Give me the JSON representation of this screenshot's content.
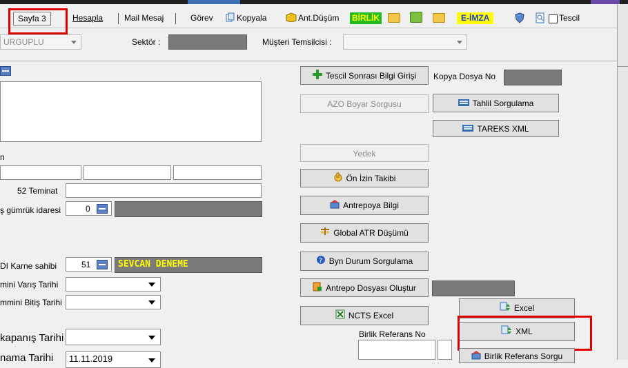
{
  "toolbar": {
    "sayfa3": "Sayfa 3",
    "hesapla": "Hesapla",
    "mail": "Mail Mesaj",
    "gorev": "Görev",
    "kopyala": "Kopyala",
    "ant_dusum": "Ant.Düşüm",
    "birlik": "BİRLİK",
    "eimza": "E-İMZA",
    "tescil": "Tescil"
  },
  "filters": {
    "office_value": "URGUPLU",
    "sektor_label": "Sektör :",
    "musteri_label": "Müşteri Temsilcisi :"
  },
  "left": {
    "fragment_n": "n",
    "teminat_label": "52 Teminat",
    "gumruk_label": "ş gümrük idaresi",
    "gumruk_value": "0",
    "karne_label": "DI Karne sahibi",
    "karne_value": "51",
    "karne_name": "SEVCAN DENEME",
    "varis_label": "mini Varış Tarihi",
    "bitis_label": "mmini Bitiş Tarihi",
    "kapanis_label": "kapanış Tarihi",
    "bottom_label": "nama Tarihi",
    "bottom_value": "11.11.2019"
  },
  "buttons": {
    "tescil_sonrasi": "Tescil Sonrası Bilgi Girişi",
    "azo": "AZO Boyar Sorgusu",
    "yedek": "Yedek",
    "on_izin": "Ön İzin Takibi",
    "antrepoya": "Antrepoya Bilgi",
    "global_atr": "Global ATR Düşümü",
    "byn_durum": "Byn Durum Sorgulama",
    "antrepo_dosyasi": "Antrepo Dosyası Oluştur",
    "ncts_excel": "NCTS Excel",
    "tahlil": "Tahlil Sorgulama",
    "tareks": "TAREKS XML",
    "excel": "Excel",
    "xml": "XML",
    "birlik_ref_sorgu": "Birlik Referans Sorgu"
  },
  "labels": {
    "kopya_dosya": "Kopya Dosya No",
    "birlik_ref_no": "Birlik Referans No"
  },
  "colors": {
    "highlight_red": "#e00000",
    "birlik_bg": "#22bb22",
    "eimza_bg": "#ffff00",
    "karne_bg": "#7a7a7a"
  }
}
